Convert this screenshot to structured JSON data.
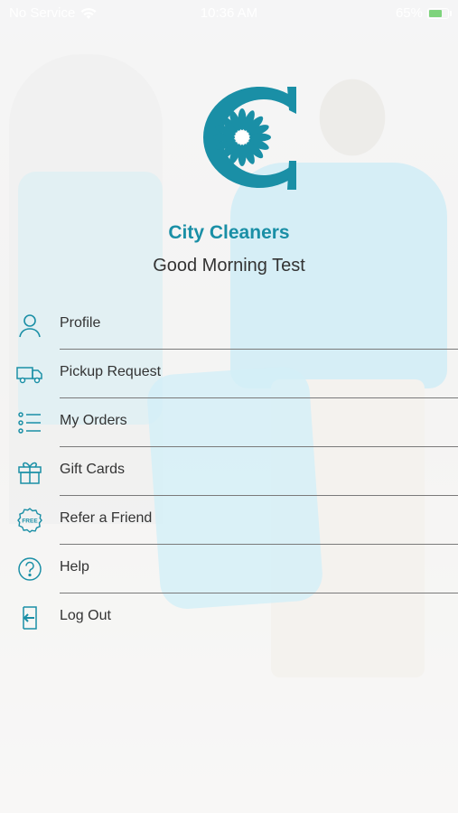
{
  "status_bar": {
    "carrier": "No Service",
    "time": "10:36 AM",
    "battery": "65%",
    "battery_level": 0.65
  },
  "brand": {
    "name": "City Cleaners",
    "greeting": "Good Morning Test",
    "accent": "#1a8fa6"
  },
  "menu": [
    {
      "label": "Profile",
      "icon": "person-icon"
    },
    {
      "label": "Pickup Request",
      "icon": "truck-icon"
    },
    {
      "label": "My Orders",
      "icon": "list-icon"
    },
    {
      "label": "Gift Cards",
      "icon": "gift-icon"
    },
    {
      "label": "Refer a Friend",
      "icon": "free-badge-icon",
      "icon_text": "FREE"
    },
    {
      "label": "Help",
      "icon": "help-icon"
    },
    {
      "label": "Log Out",
      "icon": "logout-icon"
    }
  ]
}
